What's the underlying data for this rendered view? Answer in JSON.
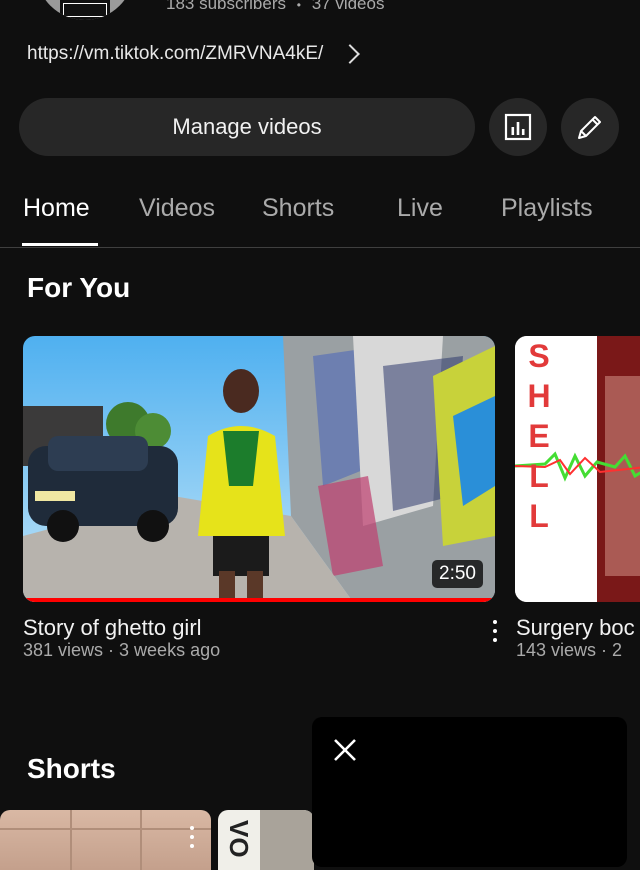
{
  "channel": {
    "subscribers": "183 subscribers",
    "separator": "•",
    "videos_count": "37 videos",
    "link": "https://vm.tiktok.com/ZMRVNA4kE/"
  },
  "actions": {
    "manage_label": "Manage videos",
    "analytics_icon": "analytics-icon",
    "edit_icon": "pencil-icon"
  },
  "tabs": [
    {
      "label": "Home",
      "active": true
    },
    {
      "label": "Videos",
      "active": false
    },
    {
      "label": "Shorts",
      "active": false
    },
    {
      "label": "Live",
      "active": false
    },
    {
      "label": "Playlists",
      "active": false
    }
  ],
  "for_you": {
    "title": "For You",
    "videos": [
      {
        "title": "Story of ghetto girl",
        "meta": "381 views · 3 weeks ago",
        "duration": "2:50",
        "progress": 1.0
      },
      {
        "title": "Surgery boc",
        "meta": "143 views · 2",
        "thumb_text": "SHELL"
      }
    ]
  },
  "shorts": {
    "title": "Shorts",
    "thumb2_text": "VO"
  },
  "miniplayer": {
    "close_icon": "close-icon"
  },
  "colors": {
    "background": "#0f0f0f",
    "button_bg": "#272727",
    "progress_red": "#ff0000",
    "secondary_text": "#aaaaaa"
  }
}
